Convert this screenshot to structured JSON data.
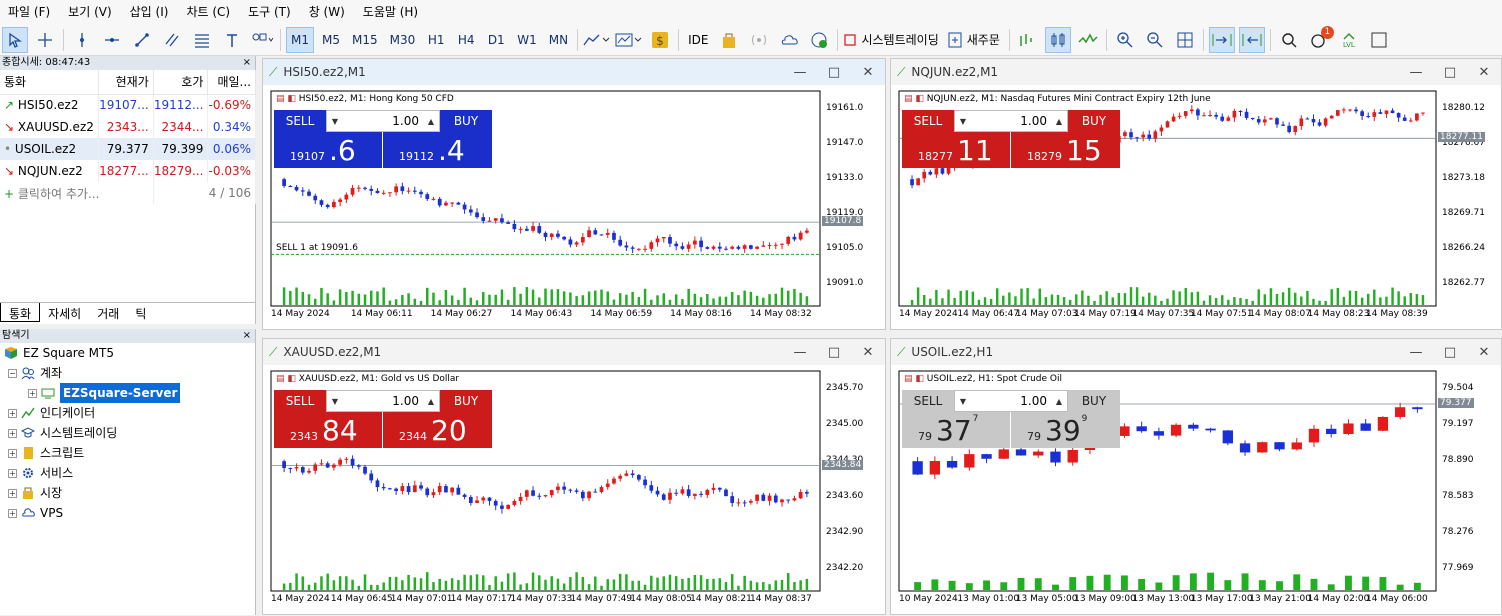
{
  "menu": [
    "파일 (F)",
    "보기 (V)",
    "삽입 (I)",
    "차트 (C)",
    "도구 (T)",
    "창 (W)",
    "도움말 (H)"
  ],
  "toolbar": {
    "timeframes": [
      "M1",
      "M5",
      "M15",
      "M30",
      "H1",
      "H4",
      "D1",
      "W1",
      "MN"
    ],
    "selected_timeframe": "M1",
    "ide_label": "IDE",
    "algo_label": "시스템트레이딩",
    "new_order_label": "새주문",
    "notification_count": "1",
    "lvl_label": "LVL"
  },
  "market_watch": {
    "title": "종합시세: 08:47:43",
    "columns": [
      "통화",
      "현재가",
      "호가",
      "매일..."
    ],
    "rows": [
      {
        "symbol": "HSI50.ez2",
        "bid": "19107...",
        "ask": "19112...",
        "change": "-0.69%",
        "dir": "up"
      },
      {
        "symbol": "XAUUSD.ez2",
        "bid": "2343...",
        "ask": "2344...",
        "change": "0.34%",
        "dir": "down"
      },
      {
        "symbol": "USOIL.ez2",
        "bid": "79.377",
        "ask": "79.399",
        "change": "0.06%",
        "dir": "none"
      },
      {
        "symbol": "NQJUN.ez2",
        "bid": "18277...",
        "ask": "18279...",
        "change": "-0.03%",
        "dir": "down"
      }
    ],
    "add_label": "클릭하여 추가...",
    "count": "4 / 106",
    "tabs": [
      "통화",
      "자세히",
      "거래",
      "틱"
    ]
  },
  "navigator": {
    "title": "탐색기",
    "root": "EZ Square MT5",
    "items": [
      "계좌",
      "EZSquare-Server",
      "인디케이터",
      "시스템트레이딩",
      "스크립트",
      "서비스",
      "시장",
      "VPS"
    ]
  },
  "charts": [
    {
      "title": "HSI50.ez2,M1",
      "label": "HSI50.ez2, M1:  Hong Kong 50 CFD",
      "sell": "SELL",
      "buy": "BUY",
      "lot": "1.00",
      "bid_small": "19107",
      "bid_big": ".6",
      "ask_small": "19112",
      "ask_big": ".4",
      "bid_sup": "",
      "ask_sup": "",
      "panel_color": "#1a2fc9",
      "yticks": [
        "19161.0",
        "19147.0",
        "19133.0",
        "19119.0",
        "19105.0",
        "19091.0"
      ],
      "price_tag": "19107.8",
      "order_line": "SELL 1 at 19091.6",
      "xticks": [
        "14 May 2024",
        "14 May 06:11",
        "14 May 06:27",
        "14 May 06:43",
        "14 May 06:59",
        "14 May 08:16",
        "14 May 08:32"
      ]
    },
    {
      "title": "NQJUN.ez2,M1",
      "label": "NQJUN.ez2, M1:  Nasdaq Futures Mini Contract Expiry 12th June",
      "sell": "SELL",
      "buy": "BUY",
      "lot": "1.00",
      "bid_small": "18277",
      "bid_big": "11",
      "ask_small": "18279",
      "ask_big": "15",
      "bid_sup": "",
      "ask_sup": "",
      "panel_color": "#cc1b1b",
      "yticks": [
        "18280.12",
        "18276.67",
        "18273.18",
        "18269.71",
        "18266.24",
        "18262.77"
      ],
      "price_tag": "18277.11",
      "order_line": "",
      "xticks": [
        "14 May 2024",
        "14 May 06:47",
        "14 May 07:03",
        "14 May 07:19",
        "14 May 07:35",
        "14 May 07:51",
        "14 May 08:07",
        "14 May 08:23",
        "14 May 08:39"
      ]
    },
    {
      "title": "XAUUSD.ez2,M1",
      "label": "XAUUSD.ez2, M1:  Gold vs US Dollar",
      "sell": "SELL",
      "buy": "BUY",
      "lot": "1.00",
      "bid_small": "2343",
      "bid_big": "84",
      "ask_small": "2344",
      "ask_big": "20",
      "bid_sup": "",
      "ask_sup": "",
      "panel_color": "#cc1b1b",
      "yticks": [
        "2345.70",
        "2345.00",
        "2344.30",
        "2343.60",
        "2342.90",
        "2342.20"
      ],
      "price_tag": "2343.84",
      "order_line": "",
      "xticks": [
        "14 May 2024",
        "14 May 06:45",
        "14 May 07:01",
        "14 May 07:17",
        "14 May 07:33",
        "14 May 07:49",
        "14 May 08:05",
        "14 May 08:21",
        "14 May 08:37"
      ]
    },
    {
      "title": "USOIL.ez2,H1",
      "label": "USOIL.ez2, H1:  Spot Crude Oil",
      "sell": "SELL",
      "buy": "BUY",
      "lot": "1.00",
      "bid_small": "79",
      "bid_big": "37",
      "ask_small": "79",
      "ask_big": "39",
      "bid_sup": "7",
      "ask_sup": "9",
      "panel_color": "#c8c8c8",
      "yticks": [
        "79.504",
        "79.197",
        "78.890",
        "78.583",
        "78.276",
        "77.969"
      ],
      "price_tag": "79.377",
      "order_line": "",
      "xticks": [
        "10 May 2024",
        "13 May 01:00",
        "13 May 05:00",
        "13 May 09:00",
        "13 May 13:00",
        "13 May 17:00",
        "13 May 21:00",
        "14 May 02:00",
        "14 May 06:00"
      ]
    }
  ],
  "colors": {
    "up": "#e31b1b",
    "down": "#1a2fd6",
    "volume": "#22b022",
    "grid": "#7f8a94"
  }
}
